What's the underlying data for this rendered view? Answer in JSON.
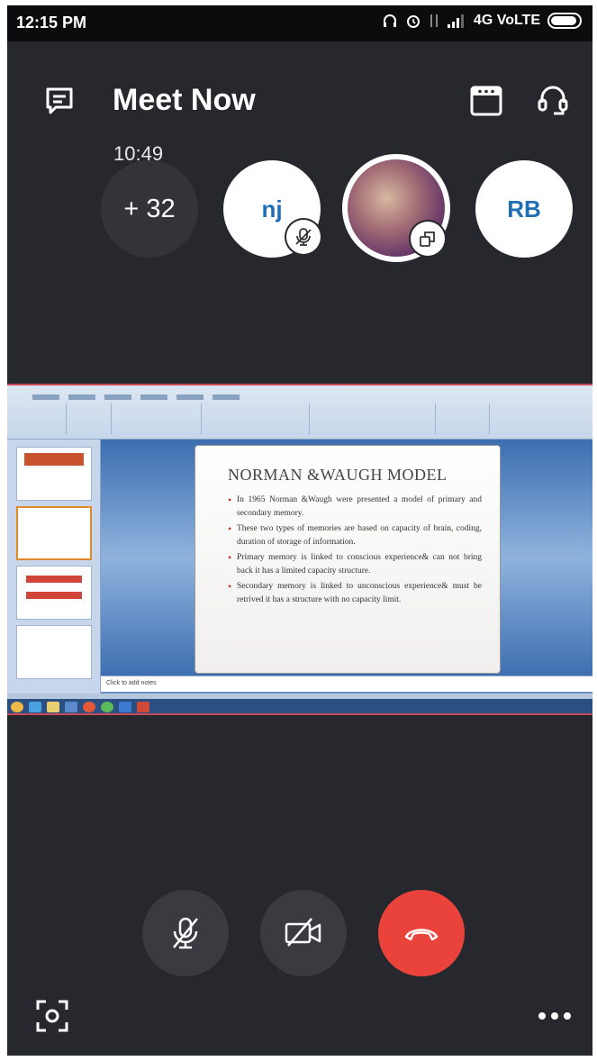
{
  "status_bar": {
    "time": "12:15 PM",
    "network": "4G VoLTE"
  },
  "header": {
    "title": "Meet Now",
    "duration": "10:49"
  },
  "participants": {
    "more_count": "+ 32",
    "avatars": [
      {
        "initials": "nj",
        "muted": true
      },
      {
        "initials": "",
        "video": true
      },
      {
        "initials": "RB"
      }
    ]
  },
  "shared_screen": {
    "slide_title": "NORMAN &WAUGH MODEL",
    "bullets": [
      "In 1965 Norman &Waugh were presented a model of primary and secondary memory.",
      "These two types of memories are based on capacity of brain, coding, duration of storage of information.",
      "Primary memory is linked to conscious experience& can not bring back it has a limited capacity structure.",
      "Secondary memory is linked to unconscious experience& must be retrived it has a structure with no capacity limit."
    ],
    "notes_placeholder": "Click to add notes"
  },
  "colors": {
    "background": "#27282d",
    "hangup": "#ea433b",
    "avatar_text": "#1f6fb6"
  }
}
